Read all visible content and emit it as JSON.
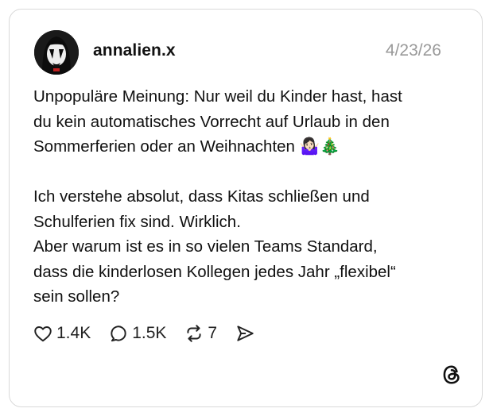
{
  "post": {
    "username": "annalien.x",
    "date": "4/23/26",
    "paragraph1": [
      "Unpopuläre Meinung: Nur weil du Kinder hast, hast",
      "du kein automatisches Vorrecht auf Urlaub in den",
      "Sommerferien oder an Weihnachten 🤷🏻‍♀️🎄"
    ],
    "paragraph2": [
      "Ich verstehe absolut, dass Kitas schließen und",
      "Schulferien fix sind. Wirklich.",
      "Aber warum ist es in so vielen Teams Standard,",
      "dass die kinderlosen Kollegen jedes Jahr „flexibel“",
      "sein sollen?"
    ]
  },
  "actions": {
    "likes": "1.4K",
    "replies": "1.5K",
    "reposts": "7",
    "icons": [
      "heart-icon",
      "reply-icon",
      "repost-icon",
      "share-icon"
    ]
  },
  "brand": {
    "logo": "threads-logo-icon"
  }
}
